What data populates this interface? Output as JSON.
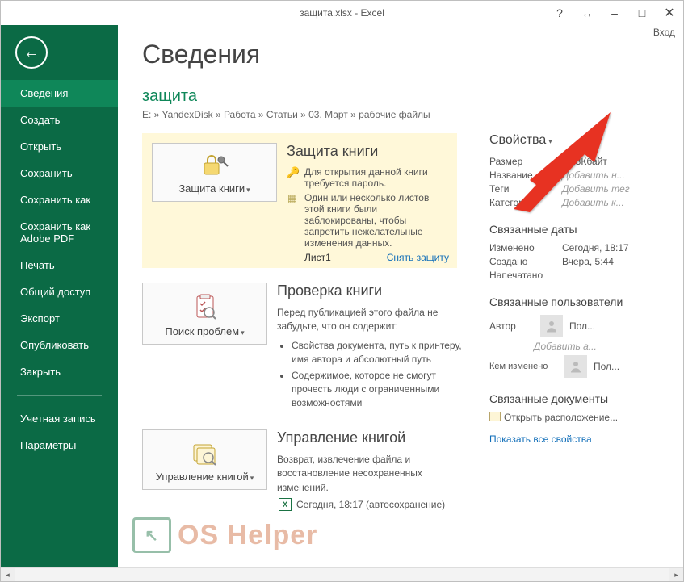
{
  "title_bar": {
    "title": "защита.xlsx - Excel",
    "login": "Вход"
  },
  "controls": {
    "help": "?",
    "fullwidth": "↔",
    "min": "–",
    "max": "□",
    "close": "✕"
  },
  "sidebar": {
    "items": [
      {
        "label": "Сведения"
      },
      {
        "label": "Создать"
      },
      {
        "label": "Открыть"
      },
      {
        "label": "Сохранить"
      },
      {
        "label": "Сохранить как"
      },
      {
        "label": "Сохранить как Adobe PDF"
      },
      {
        "label": "Печать"
      },
      {
        "label": "Общий доступ"
      },
      {
        "label": "Экспорт"
      },
      {
        "label": "Опубликовать"
      },
      {
        "label": "Закрыть"
      },
      {
        "label": "Учетная запись"
      },
      {
        "label": "Параметры"
      }
    ]
  },
  "page": {
    "h1": "Сведения",
    "filename": "защита",
    "path": "E: » YandexDisk » Работа » Статьи » 03. Март » рабочие файлы"
  },
  "protect": {
    "btn": "Защита книги",
    "title": "Защита книги",
    "note1": "Для открытия данной книги требуется пароль.",
    "note2": "Один или несколько листов этой книги были заблокированы, чтобы запретить нежелательные изменения данных.",
    "sheet": "Лист1",
    "action": "Снять защиту"
  },
  "inspect": {
    "btn": "Поиск проблем",
    "title": "Проверка книги",
    "desc": "Перед публикацией этого файла не забудьте, что он содержит:",
    "b1": "Свойства документа, путь к принтеру, имя автора и абсолютный путь",
    "b2": "Содержимое, которое не смогут прочесть люди с ограниченными возможностями"
  },
  "manage": {
    "btn": "Управление книгой",
    "title": "Управление книгой",
    "desc": "Возврат, извлечение файла и восстановление несохраненных изменений.",
    "auto": "Сегодня, 18:17 (автосохранение)"
  },
  "props": {
    "head": "Свойства",
    "size_l": "Размер",
    "size_v": "16,3Кбайт",
    "name_l": "Название",
    "name_v": "Добавить н...",
    "tags_l": "Теги",
    "tags_v": "Добавить тег",
    "cat_l": "Категории",
    "cat_v": "Добавить к...",
    "dates_head": "Связанные даты",
    "mod_l": "Изменено",
    "mod_v": "Сегодня, 18:17",
    "cre_l": "Создано",
    "cre_v": "Вчера, 5:44",
    "prn_l": "Напечатано",
    "prn_v": "",
    "users_head": "Связанные пользователи",
    "author_l": "Автор",
    "author_v": "Пол...",
    "add_author": "Добавить а...",
    "changed_l": "Кем изменено",
    "changed_v": "Пол...",
    "docs_head": "Связанные документы",
    "open_loc": "Открыть расположение...",
    "show_all": "Показать все свойства"
  }
}
